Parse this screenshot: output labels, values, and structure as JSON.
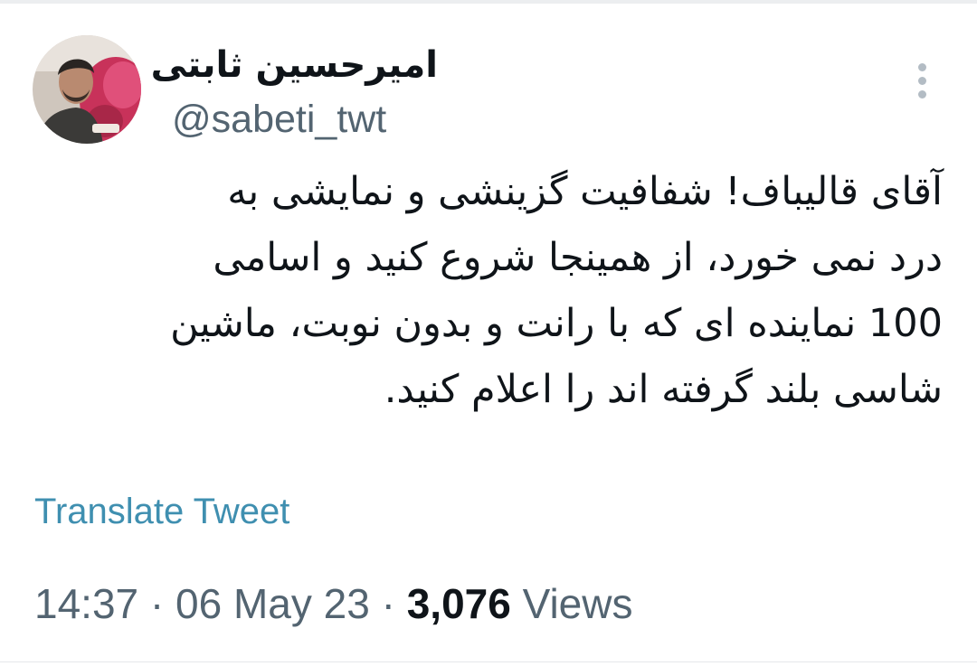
{
  "tweet": {
    "author": {
      "display_name": "امیرحسین ثابتی",
      "handle": "@sabeti_twt"
    },
    "more_icon": "more-vertical-icon",
    "body_lines": [
      "آقای قالیباف! شفافیت گزینشی و نمایشی به",
      "درد نمی خورد، از همینجا شروع کنید و اسامی",
      "100 نماینده ای که با رانت و بدون نوبت، ماشین",
      "شاسی بلند گرفته اند را اعلام کنید."
    ],
    "translate_label": "Translate Tweet",
    "meta": {
      "time": "14:37",
      "separator": "·",
      "date": "06 May 23",
      "views_count": "3,076",
      "views_label": "Views"
    }
  },
  "colors": {
    "text_primary": "#0f1419",
    "text_secondary": "#536471",
    "link": "#3f8fb0",
    "icon_gray": "#b3bcc4"
  }
}
